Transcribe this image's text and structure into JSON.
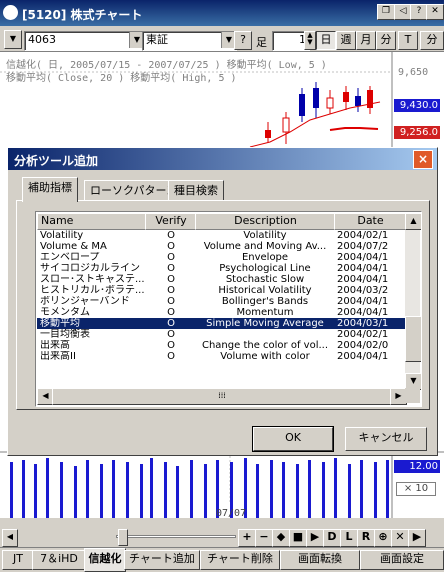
{
  "window": {
    "title": "[5120] 株式チャート"
  },
  "toolbar": {
    "code_value": "4063",
    "market_value": "東証",
    "help_label": "?",
    "bar_label": "足",
    "period_value": "1",
    "day_label": "日",
    "week_label": "週",
    "month_label": "月",
    "minute_label": "分",
    "t_label": "T",
    "extra_label": "分"
  },
  "chart": {
    "info_line1": "信越化( 日, 2005/07/15 - 2007/07/25 )  移動平均( Low, 5 )",
    "info_line2": "移動平均( Close, 20 )   移動平均( High, 5 )",
    "price_top": "9,650",
    "price_label_1": "9,430.0",
    "price_label_2": "9,256.0",
    "volume_label": "12.00",
    "volume_scale": "× 10",
    "date_label": "07/07"
  },
  "dialog": {
    "title": "分析ツール追加",
    "close_label": "×",
    "tabs": [
      {
        "label": "補助指標"
      },
      {
        "label": "ローソクパターン"
      },
      {
        "label": "種目検索"
      }
    ],
    "columns": [
      "Name",
      "Verify",
      "Description",
      "Date"
    ],
    "rows": [
      {
        "name": "Volatility",
        "verify": "O",
        "description": "Volatility",
        "date": "2004/02/1"
      },
      {
        "name": "Volume & MA",
        "verify": "O",
        "description": "Volume and Moving Av...",
        "date": "2004/07/2"
      },
      {
        "name": "エンベロープ",
        "verify": "O",
        "description": "Envelope",
        "date": "2004/04/1"
      },
      {
        "name": "サイコロジカルライン",
        "verify": "O",
        "description": "Psychological Line",
        "date": "2004/04/1"
      },
      {
        "name": "スロー･ストキャステ...",
        "verify": "O",
        "description": "Stochastic Slow",
        "date": "2004/04/1"
      },
      {
        "name": "ヒストリカル･ボラテ...",
        "verify": "O",
        "description": "Historical Volatility",
        "date": "2004/03/2"
      },
      {
        "name": "ボリンジャーバンド",
        "verify": "O",
        "description": "Bollinger's Bands",
        "date": "2004/04/1"
      },
      {
        "name": "モメンタム",
        "verify": "O",
        "description": "Momentum",
        "date": "2004/04/1"
      },
      {
        "name": "移動平均",
        "verify": "O",
        "description": "Simple Moving Average",
        "date": "2004/03/1"
      },
      {
        "name": "一目均衡表",
        "verify": "O",
        "description": "",
        "date": "2004/02/1"
      },
      {
        "name": "出来高",
        "verify": "O",
        "description": "Change the color of vol...",
        "date": "2004/02/0"
      },
      {
        "name": "出来高II",
        "verify": "O",
        "description": "Volume with color",
        "date": "2004/04/1"
      }
    ],
    "selected_index": 8,
    "ok_label": "OK",
    "cancel_label": "キャンセル"
  },
  "nav": {
    "buttons": [
      "+",
      "−",
      "◆",
      "■",
      "▶",
      "D",
      "L",
      "R",
      "⊕",
      "✕",
      "▶"
    ]
  },
  "bottom_tabs": {
    "items": [
      "JT",
      "7＆iHD",
      "信越化"
    ],
    "actions": [
      "チャート追加",
      "チャート削除",
      "画面転換",
      "画面設定"
    ]
  }
}
